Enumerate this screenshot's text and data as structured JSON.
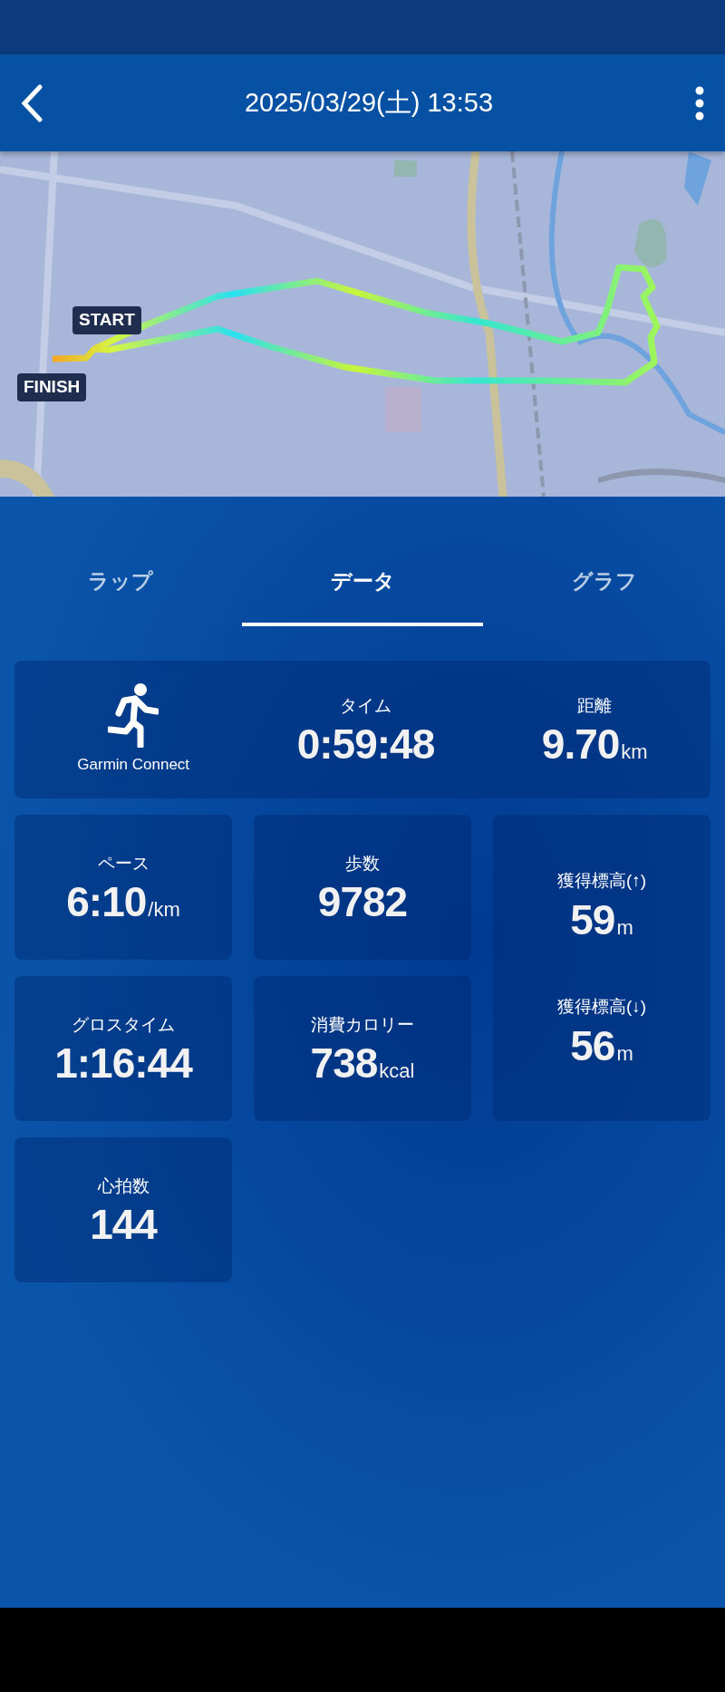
{
  "header": {
    "title": "2025/03/29(土) 13:53"
  },
  "map": {
    "markers": [
      {
        "kind": "start",
        "label": "START"
      },
      {
        "kind": "finish",
        "label": "FINISH"
      }
    ]
  },
  "tabs": [
    {
      "label": "ラップ",
      "selected": false
    },
    {
      "label": "データ",
      "selected": true
    },
    {
      "label": "グラフ",
      "selected": false
    }
  ],
  "summary": {
    "source": "Garmin Connect",
    "stats": [
      {
        "label": "タイム",
        "value": "0:59:48"
      },
      {
        "label": "距離",
        "value": "9.70",
        "unit": "km"
      }
    ]
  },
  "stats": [
    {
      "kind": "single",
      "items": [
        {
          "label": "ペース",
          "value": "6:10",
          "unit": "/km"
        }
      ]
    },
    {
      "kind": "single",
      "items": [
        {
          "label": "歩数",
          "value": "9782"
        }
      ]
    },
    {
      "kind": "double",
      "items": [
        {
          "label": "獲得標高(↑)",
          "value": "59",
          "unit": "m"
        },
        {
          "label": "獲得標高(↓)",
          "value": "56",
          "unit": "m"
        }
      ]
    },
    {
      "kind": "single",
      "items": [
        {
          "label": "グロスタイム",
          "value": "1:16:44"
        }
      ]
    },
    {
      "kind": "single",
      "items": [
        {
          "label": "消費カロリー",
          "value": "738",
          "unit": "kcal"
        }
      ]
    },
    {
      "kind": "single",
      "items": [
        {
          "label": "心拍数",
          "value": "144"
        }
      ]
    }
  ]
}
